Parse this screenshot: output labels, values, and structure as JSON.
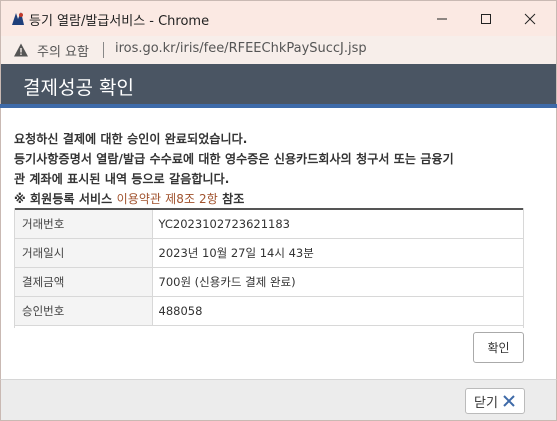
{
  "window": {
    "title": "등기 열람/발급서비스 - Chrome",
    "minimize_icon": "minimize-icon",
    "maximize_icon": "maximize-icon",
    "close_icon": "close-icon"
  },
  "addressbar": {
    "security_text": "주의 요함",
    "url": "iros.go.kr/iris/fee/RFEEChkPaySuccJ.jsp"
  },
  "dialog": {
    "title": "결제성공 확인",
    "messages": {
      "line1": "요청하신 결제에 대한 승인이 완료되었습니다.",
      "line2": "등기사항증명서 열람/발급 수수료에 대한 영수증은 신용카드회사의 청구서 또는 금융기",
      "line3": "관 계좌에 표시된 내역 등으로 갈음합니다.",
      "line4_prefix": "※ 회원등록 서비스 ",
      "line4_link": "이용약관 제8조 2항",
      "line4_suffix": " 참조"
    },
    "table": [
      {
        "label": "거래번호",
        "value": "YC2023102723621183"
      },
      {
        "label": "거래일시",
        "value": "2023년 10월 27일 14시 43분"
      },
      {
        "label": "결제금액",
        "value": "700원 (신용카드 결제 완료)"
      },
      {
        "label": "승인번호",
        "value": "488058"
      }
    ],
    "confirm_label": "확인",
    "close_label": "닫기"
  },
  "colors": {
    "header_bg": "#4a5563",
    "header_accent": "#3e6aa8",
    "link": "#a0522d",
    "titlebar_bg": "#fbe9e3"
  }
}
